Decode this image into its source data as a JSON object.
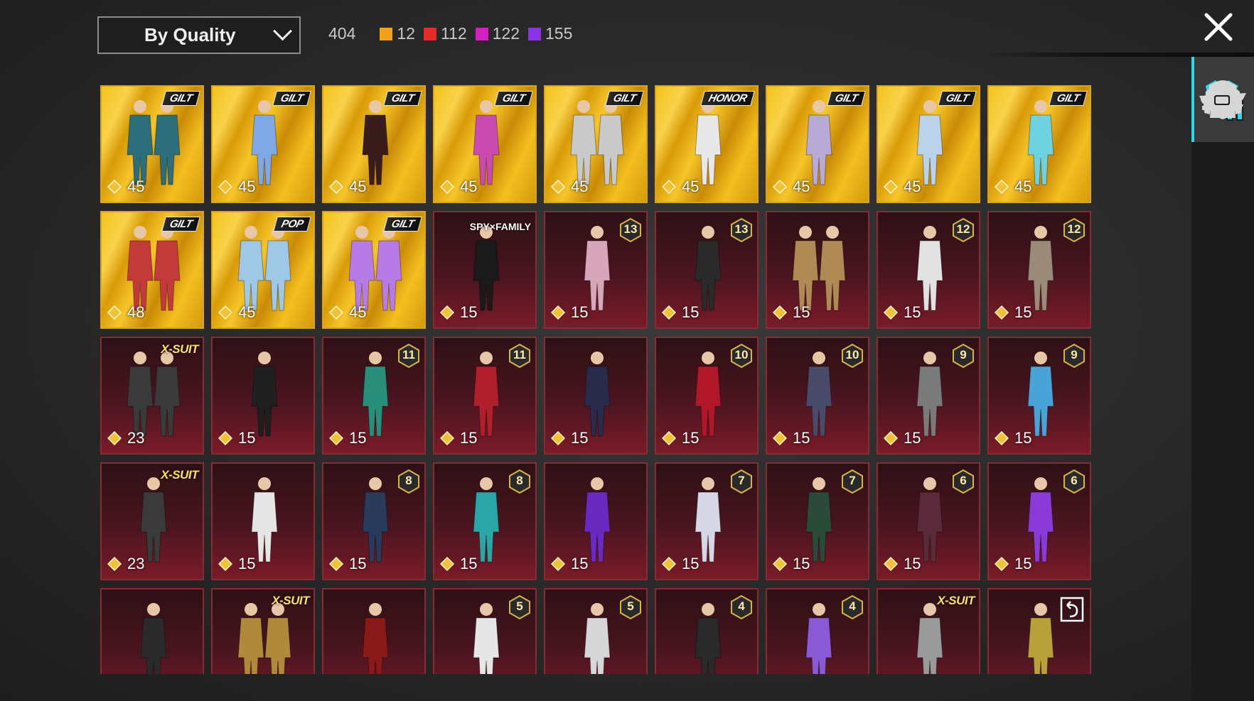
{
  "sort": {
    "label": "By Quality"
  },
  "counts": {
    "total": "404",
    "groups": [
      {
        "color": "#f0a21c",
        "count": "12"
      },
      {
        "color": "#e62a2a",
        "count": "112"
      },
      {
        "color": "#d51fc4",
        "count": "122"
      },
      {
        "color": "#8a33e8",
        "count": "155"
      }
    ]
  },
  "sidebar": {
    "accent": "#2fd6e8",
    "items": [
      {
        "icon": "outfit-icon",
        "active": true
      },
      {
        "icon": "helmet-icon"
      },
      {
        "icon": "cap-icon"
      },
      {
        "icon": "glasses-icon"
      },
      {
        "icon": "mask-icon"
      },
      {
        "icon": "jacket-icon"
      },
      {
        "icon": "backpack-icon"
      }
    ]
  },
  "items": [
    {
      "style": "gold",
      "tag": "GILT",
      "price": "45"
    },
    {
      "style": "gold",
      "tag": "GILT",
      "price": "45"
    },
    {
      "style": "gold",
      "tag": "GILT",
      "price": "45"
    },
    {
      "style": "gold",
      "tag": "GILT",
      "price": "45"
    },
    {
      "style": "gold",
      "tag": "GILT",
      "price": "45"
    },
    {
      "style": "gold",
      "tag": "HONOR",
      "price": "45"
    },
    {
      "style": "gold",
      "tag": "GILT",
      "price": "45"
    },
    {
      "style": "gold",
      "tag": "GILT",
      "price": "45"
    },
    {
      "style": "gold",
      "tag": "GILT",
      "price": "45"
    },
    {
      "style": "gold",
      "tag": "GILT",
      "price": "48"
    },
    {
      "style": "gold",
      "tag": "POP",
      "price": "45"
    },
    {
      "style": "gold",
      "tag": "GILT",
      "price": "45"
    },
    {
      "style": "red",
      "tag": "SPY×FAMILY",
      "price": "15"
    },
    {
      "style": "red",
      "level": "13",
      "price": "15"
    },
    {
      "style": "red",
      "level": "13",
      "price": "15"
    },
    {
      "style": "red",
      "price": "15"
    },
    {
      "style": "red",
      "level": "12",
      "price": "15"
    },
    {
      "style": "red",
      "level": "12",
      "price": "15"
    },
    {
      "style": "red",
      "tag": "X-SUIT",
      "price": "23"
    },
    {
      "style": "red",
      "price": "15"
    },
    {
      "style": "red",
      "level": "11",
      "price": "15"
    },
    {
      "style": "red",
      "level": "11",
      "price": "15"
    },
    {
      "style": "red",
      "price": "15"
    },
    {
      "style": "red",
      "level": "10",
      "price": "15"
    },
    {
      "style": "red",
      "level": "10",
      "price": "15"
    },
    {
      "style": "red",
      "level": "9",
      "price": "15"
    },
    {
      "style": "red",
      "level": "9",
      "price": "15"
    },
    {
      "style": "red",
      "tag": "X-SUIT",
      "price": "23"
    },
    {
      "style": "red",
      "price": "15"
    },
    {
      "style": "red",
      "level": "8",
      "price": "15"
    },
    {
      "style": "red",
      "level": "8",
      "price": "15"
    },
    {
      "style": "red",
      "price": "15"
    },
    {
      "style": "red",
      "level": "7",
      "price": "15"
    },
    {
      "style": "red",
      "level": "7",
      "price": "15"
    },
    {
      "style": "red",
      "level": "6",
      "price": "15"
    },
    {
      "style": "red",
      "level": "6",
      "price": "15"
    },
    {
      "style": "red"
    },
    {
      "style": "red",
      "tag": "X-SUIT"
    },
    {
      "style": "red"
    },
    {
      "style": "red",
      "level": "5"
    },
    {
      "style": "red",
      "level": "5"
    },
    {
      "style": "red",
      "level": "4"
    },
    {
      "style": "red",
      "level": "4"
    },
    {
      "style": "red",
      "tag": "X-SUIT"
    },
    {
      "style": "red",
      "undo": true
    }
  ]
}
